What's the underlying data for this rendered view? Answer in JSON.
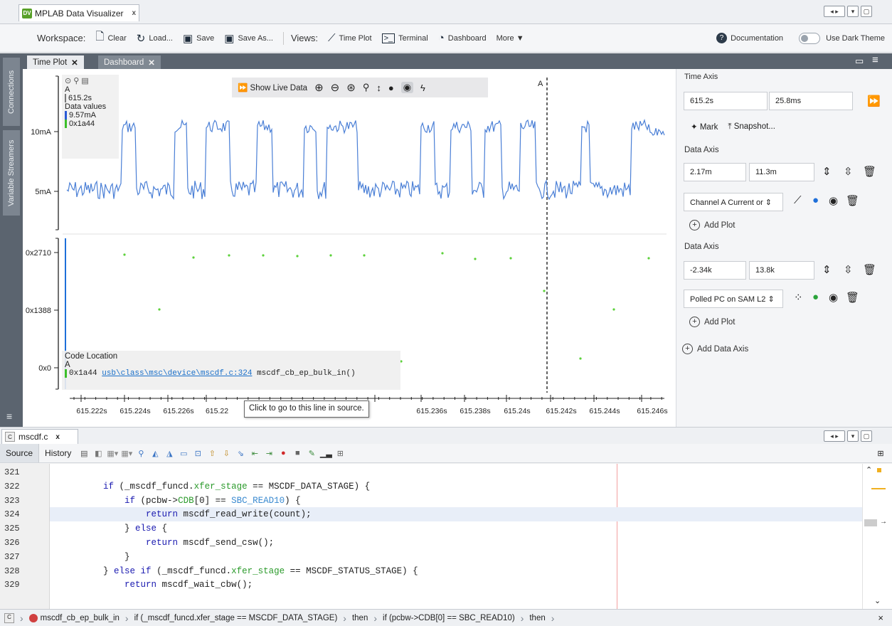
{
  "window": {
    "tab_title": "MPLAB Data Visualizer",
    "logo_text": "DV",
    "close": "x"
  },
  "toolbar": {
    "workspace_label": "Workspace:",
    "clear": "Clear",
    "load": "Load...",
    "save": "Save",
    "save_as": "Save As...",
    "views_label": "Views:",
    "time_plot": "Time Plot",
    "terminal": "Terminal",
    "dashboard": "Dashboard",
    "more": "More ▼",
    "documentation": "Documentation",
    "dark_theme": "Use Dark Theme"
  },
  "sidebar": {
    "connections": "Connections",
    "variable_streamers": "Variable Streamers"
  },
  "inner_tabs": [
    {
      "label": "Time Plot",
      "close": "✕"
    },
    {
      "label": "Dashboard",
      "close": "✕"
    }
  ],
  "plot": {
    "toolbar_live": "Show Live Data",
    "cursor_label": "A",
    "info": {
      "cursor": "A",
      "time": "615.2s",
      "data_values_label": "Data values",
      "current": "9.57mA",
      "pc": "0x1a44"
    },
    "upper_y_ticks": [
      "10mA",
      "5mA"
    ],
    "lower_y_ticks": [
      "0x2710",
      "0x1388",
      "0x0"
    ],
    "x_ticks": [
      "615.222s",
      "615.224s",
      "615.226s",
      "615.22",
      "615.236s",
      "615.238s",
      "615.24s",
      "615.242s",
      "615.244s",
      "615.246s"
    ],
    "code_location": {
      "title": "Code Location",
      "cursor": "A",
      "address": "0x1a44",
      "file_link": "usb\\class\\msc\\device\\mscdf.c:324",
      "function": "mscdf_cb_ep_bulk_in()"
    },
    "tooltip": "Click to go to this line in source."
  },
  "chart_data": [
    {
      "type": "line",
      "ylabel": "",
      "y_ticks": [
        "10mA",
        "5mA"
      ],
      "series": [
        {
          "name": "Channel A Current",
          "color": "#4a7fd6"
        }
      ],
      "y_unit": "mA"
    },
    {
      "type": "scatter",
      "y_ticks": [
        "0x2710",
        "0x1388",
        "0x0"
      ],
      "series": [
        {
          "name": "Polled PC on SAM L2",
          "color": "#5cd13a"
        }
      ]
    }
  ],
  "right_panel": {
    "time_axis_label": "Time Axis",
    "time_start": "615.2s",
    "time_span": "25.8ms",
    "mark": "Mark",
    "snapshot": "Snapshot...",
    "data_axis_label": "Data Axis",
    "axis1": {
      "min": "2.17m",
      "max": "11.3m",
      "channel": "Channel A Current or",
      "add_plot": "Add Plot",
      "drop_color": "#1e6fd9"
    },
    "axis2": {
      "min": "-2.34k",
      "max": "13.8k",
      "channel": "Polled PC on SAM L2",
      "add_plot": "Add Plot",
      "drop_color": "#2aa33a"
    },
    "add_data_axis": "Add Data Axis"
  },
  "editor": {
    "file_tab": "mscdf.c",
    "file_close": "x",
    "source": "Source",
    "history": "History",
    "lines": [
      {
        "n": "321",
        "code": ""
      },
      {
        "n": "322",
        "code": "    if (_mscdf_funcd.xfer_stage == MSCDF_DATA_STAGE) {"
      },
      {
        "n": "323",
        "code": "        if (pcbw->CDB[0] == SBC_READ10) {"
      },
      {
        "n": "324",
        "code": "            return mscdf_read_write(count);"
      },
      {
        "n": "325",
        "code": "        } else {"
      },
      {
        "n": "326",
        "code": "            return mscdf_send_csw();"
      },
      {
        "n": "327",
        "code": "        }"
      },
      {
        "n": "328",
        "code": "    } else if (_mscdf_funcd.xfer_stage == MSCDF_STATUS_STAGE) {"
      },
      {
        "n": "329",
        "code": "        return mscdf_wait_cbw();"
      }
    ]
  },
  "breadcrumb": {
    "items": [
      "mscdf_cb_ep_bulk_in",
      "if (_mscdf_funcd.xfer_stage == MSCDF_DATA_STAGE)",
      "then",
      "if (pcbw->CDB[0] == SBC_READ10)",
      "then"
    ],
    "close": "×"
  }
}
